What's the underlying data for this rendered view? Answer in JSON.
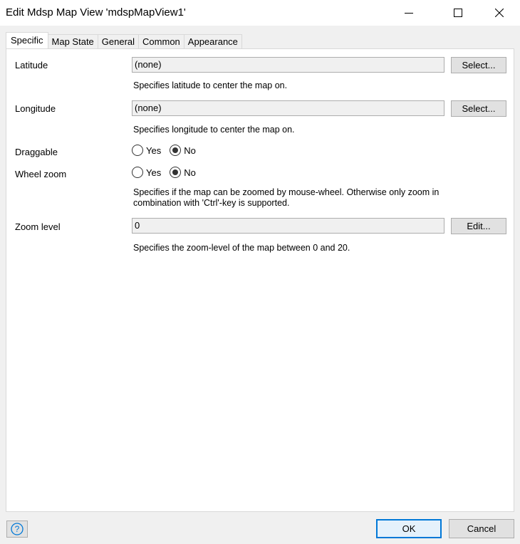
{
  "window": {
    "title": "Edit Mdsp Map View 'mdspMapView1'",
    "minimize_icon": "minimize-icon",
    "maximize_icon": "maximize-icon",
    "close_icon": "close-icon"
  },
  "tabs": [
    {
      "label": "Specific",
      "active": true
    },
    {
      "label": "Map State",
      "active": false
    },
    {
      "label": "General",
      "active": false
    },
    {
      "label": "Common",
      "active": false
    },
    {
      "label": "Appearance",
      "active": false
    }
  ],
  "specific": {
    "latitude": {
      "label": "Latitude",
      "value": "(none)",
      "button": "Select...",
      "help": "Specifies latitude to center the map on."
    },
    "longitude": {
      "label": "Longitude",
      "value": "(none)",
      "button": "Select...",
      "help": "Specifies longitude to center the map on."
    },
    "draggable": {
      "label": "Draggable",
      "yes": "Yes",
      "no": "No",
      "selected": "No"
    },
    "wheel_zoom": {
      "label": "Wheel zoom",
      "yes": "Yes",
      "no": "No",
      "selected": "No",
      "help_line1": "Specifies if the map can be zoomed by mouse-wheel. Otherwise only zoom in",
      "help_line2": "combination with 'Ctrl'-key is supported."
    },
    "zoom_level": {
      "label": "Zoom level",
      "value": "0",
      "button": "Edit...",
      "help": "Specifies the zoom-level of the map between 0 and 20."
    }
  },
  "footer": {
    "help_icon": "question-icon",
    "ok": "OK",
    "cancel": "Cancel"
  },
  "colors": {
    "accent": "#0078d7",
    "panel_bg": "#ffffff",
    "window_bg": "#f0f0f0"
  }
}
